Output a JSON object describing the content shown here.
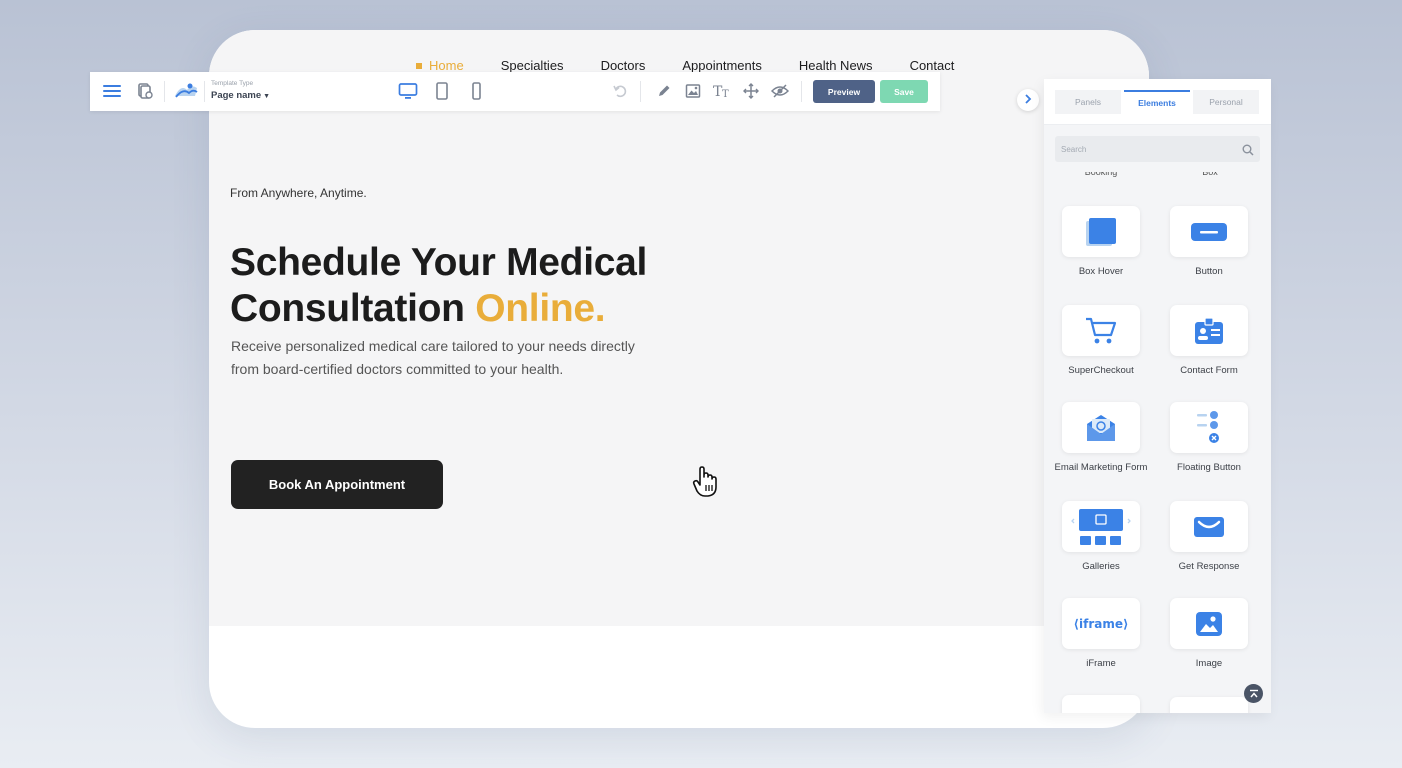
{
  "site": {
    "nav": [
      "Home",
      "Specialties",
      "Doctors",
      "Appointments",
      "Health News",
      "Contact"
    ],
    "tagline": "From Anywhere, Anytime.",
    "headline_line1": "Schedule Your Medical",
    "headline_line2": "Consultation ",
    "headline_accent": "Online.",
    "subtext": "Receive personalized medical care tailored to your needs directly from board-certified doctors committed to your health.",
    "cta_label": "Book An Appointment"
  },
  "toolbar": {
    "template_type_label": "Template Type",
    "page_name": "Page name",
    "preview_label": "Preview",
    "save_label": "Save"
  },
  "panel": {
    "tabs": [
      "Panels",
      "Elements",
      "Personal"
    ],
    "active_tab": "Elements",
    "search_placeholder": "Search",
    "cut_labels": [
      "Booking",
      "Box"
    ],
    "elements": [
      {
        "label": "Box Hover",
        "icon": "box-hover-icon"
      },
      {
        "label": "Button",
        "icon": "button-icon"
      },
      {
        "label": "SuperCheckout",
        "icon": "cart-icon"
      },
      {
        "label": "Contact Form",
        "icon": "contact-form-icon"
      },
      {
        "label": "Email Marketing Form",
        "icon": "email-marketing-icon"
      },
      {
        "label": "Floating Button",
        "icon": "floating-button-icon"
      },
      {
        "label": "Galleries",
        "icon": "galleries-icon"
      },
      {
        "label": "Get Response",
        "icon": "get-response-icon"
      },
      {
        "label": "iFrame",
        "icon": "iframe-icon"
      },
      {
        "label": "Image",
        "icon": "image-icon"
      }
    ],
    "iframe_icon_text": "iframe"
  },
  "colors": {
    "accent": "#e9ad3a",
    "element_blue": "#3b7de0",
    "preview": "#4f6287",
    "save": "#7ed8b2"
  }
}
